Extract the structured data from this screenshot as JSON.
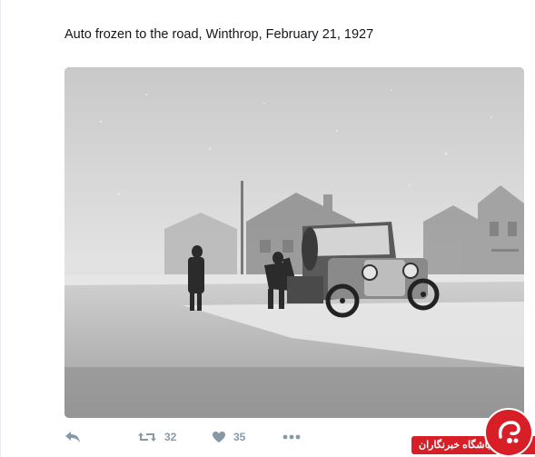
{
  "tweet": {
    "text": "Auto frozen to the road, Winthrop, February 21, 1927"
  },
  "media": {
    "description_icon": "photo"
  },
  "actions": {
    "reply_icon": "reply-icon",
    "retweet_icon": "retweet-icon",
    "retweet_count": "32",
    "like_icon": "heart-icon",
    "like_count": "35",
    "more_icon": "more-icon"
  },
  "watermark": {
    "label": "باشگاه خبرنگاران"
  },
  "colors": {
    "text": "#14171a",
    "action": "#8899a6",
    "watermark": "#d81e27"
  }
}
